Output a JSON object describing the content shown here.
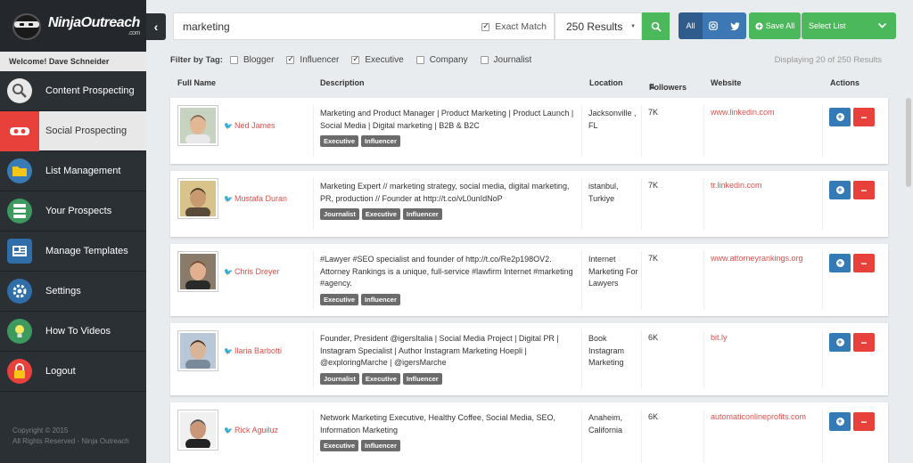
{
  "app": {
    "logo_text": "NinjaOutreach",
    "logo_sub": ".com",
    "welcome_prefix": "Welcome!",
    "user_name": "Dave Schneider",
    "copyright_line1": "Copyright © 2015",
    "copyright_line2": "All Rights Reserved - Ninja Outreach"
  },
  "sidebar": {
    "items": [
      {
        "label": "Content Prospecting",
        "icon": "magnifier-icon"
      },
      {
        "label": "Social Prospecting",
        "icon": "ninja-mask-icon"
      },
      {
        "label": "List Management",
        "icon": "folder-icon"
      },
      {
        "label": "Your Prospects",
        "icon": "database-icon"
      },
      {
        "label": "Manage Templates",
        "icon": "template-icon"
      },
      {
        "label": "Settings",
        "icon": "gear-icon"
      },
      {
        "label": "How To Videos",
        "icon": "lightbulb-icon"
      },
      {
        "label": "Logout",
        "icon": "lock-icon"
      }
    ],
    "active_index": 1
  },
  "search": {
    "query": "marketing",
    "exact_match_label": "Exact Match",
    "exact_match_checked": true,
    "results_selected": "250 Results"
  },
  "toolbar": {
    "all_label": "All",
    "save_all_label": "Save All",
    "select_list_label": "Select List"
  },
  "filters": {
    "label": "Filter by Tag:",
    "tags": [
      {
        "label": "Blogger",
        "checked": false
      },
      {
        "label": "Influencer",
        "checked": true
      },
      {
        "label": "Executive",
        "checked": true
      },
      {
        "label": "Company",
        "checked": false
      },
      {
        "label": "Journalist",
        "checked": false
      }
    ],
    "displaying": "Displaying 20 of 250 Results"
  },
  "table": {
    "headers": {
      "full_name": "Full Name",
      "description": "Description",
      "location": "Location",
      "followers": "Followers",
      "website": "Website",
      "actions": "Actions"
    },
    "rows": [
      {
        "name": "Ned James",
        "description": "Marketing and Product Manager | Product Marketing | Product Launch | Social Media | Digital marketing | B2B & B2C",
        "tags": [
          "Executive",
          "Influencer"
        ],
        "location": "Jacksonville , FL",
        "followers": "7K",
        "website": "www.linkedin.com"
      },
      {
        "name": "Mustafa Duran",
        "description": "Marketing Expert // marketing strategy, social media, digital marketing, PR, production // Founder at http://t.co/vL0unIdNoP",
        "tags": [
          "Journalist",
          "Executive",
          "Influencer"
        ],
        "location": "istanbul, Turkiye",
        "followers": "7K",
        "website": "tr.linkedin.com"
      },
      {
        "name": "Chris Dreyer",
        "description": "#Lawyer #SEO specialist and founder of http://t.co/Re2p198OV2. Attorney Rankings is a unique, full-service #lawfirm Internet #marketing #agency.",
        "tags": [
          "Executive",
          "Influencer"
        ],
        "location": "Internet Marketing For Lawyers",
        "followers": "7K",
        "website": "www.attorneyrankings.org"
      },
      {
        "name": "Ilaria Barbotti",
        "description": "Founder, President @igersItalia | Social Media Project | Digital PR | Instagram Specialist | Author Instagram Marketing Hoepli | @exploringMarche | @igersMarche",
        "tags": [
          "Journalist",
          "Executive",
          "Influencer"
        ],
        "location": "Book Instagram Marketing",
        "followers": "6K",
        "website": "bit.ly"
      },
      {
        "name": "Rick Aguiluz",
        "description": "Network Marketing Executive, Healthy Coffee, Social Media, SEO, Information Marketing",
        "tags": [
          "Executive",
          "Influencer"
        ],
        "location": "Anaheim, California",
        "followers": "6K",
        "website": "automaticonlineprofits.com"
      }
    ]
  },
  "colors": {
    "accent_red": "#e8403b",
    "accent_green": "#4cb85c",
    "accent_blue": "#337ab7",
    "sidebar_bg": "#2b3035"
  }
}
